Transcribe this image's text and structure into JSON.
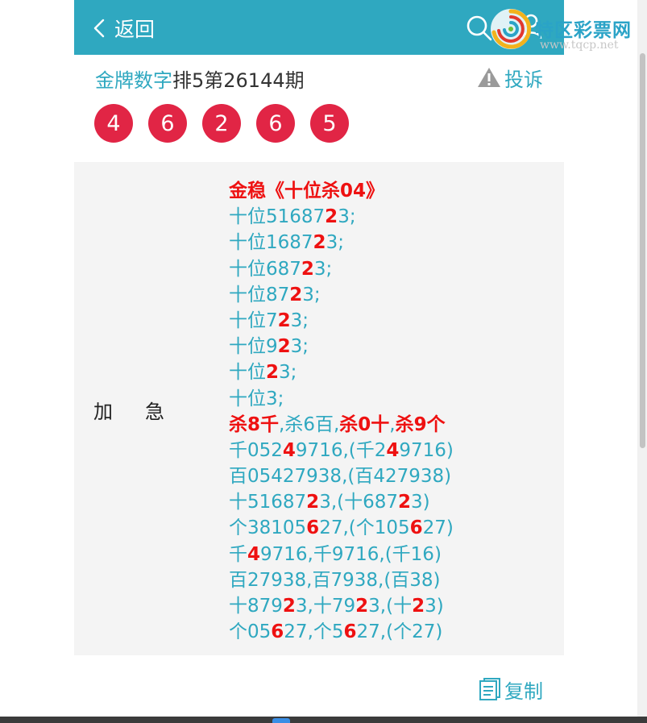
{
  "header": {
    "back_label": "返回",
    "search_icon": "search-icon",
    "user_icon": "user-icon",
    "background": "#2fa8c0"
  },
  "logo": {
    "name": "特区彩票网",
    "url": "www.tqcp.net"
  },
  "title": {
    "author": "金牌数字",
    "issue": "排5第26144期"
  },
  "complain": {
    "label": "投诉",
    "icon": "warning-icon"
  },
  "balls": [
    "4",
    "6",
    "2",
    "6",
    "5"
  ],
  "ball_color": "#e12545",
  "panel": {
    "label": "加急",
    "lines": [
      [
        {
          "t": "金稳《十位杀04》",
          "r": true
        }
      ],
      [
        {
          "t": "十位51687"
        },
        {
          "t": "2",
          "r": true
        },
        {
          "t": "3;"
        }
      ],
      [
        {
          "t": "十位1687"
        },
        {
          "t": "2",
          "r": true
        },
        {
          "t": "3;"
        }
      ],
      [
        {
          "t": "十位687"
        },
        {
          "t": "2",
          "r": true
        },
        {
          "t": "3;"
        }
      ],
      [
        {
          "t": "十位87"
        },
        {
          "t": "2",
          "r": true
        },
        {
          "t": "3;"
        }
      ],
      [
        {
          "t": "十位7"
        },
        {
          "t": "2",
          "r": true
        },
        {
          "t": "3;"
        }
      ],
      [
        {
          "t": "十位9"
        },
        {
          "t": "2",
          "r": true
        },
        {
          "t": "3;"
        }
      ],
      [
        {
          "t": "十位"
        },
        {
          "t": "2",
          "r": true
        },
        {
          "t": "3;"
        }
      ],
      [
        {
          "t": "十位3;"
        }
      ],
      [
        {
          "t": "杀8千",
          "r": true
        },
        {
          "t": ",杀6百,"
        },
        {
          "t": "杀0十",
          "r": true
        },
        {
          "t": ","
        },
        {
          "t": "杀9个",
          "r": true
        }
      ],
      [
        {
          "t": "千052"
        },
        {
          "t": "4",
          "r": true
        },
        {
          "t": "9716,(千2"
        },
        {
          "t": "4",
          "r": true
        },
        {
          "t": "9716)"
        }
      ],
      [
        {
          "t": "百05427938,(百427938)"
        }
      ],
      [
        {
          "t": "十51687"
        },
        {
          "t": "2",
          "r": true
        },
        {
          "t": "3,(十687"
        },
        {
          "t": "2",
          "r": true
        },
        {
          "t": "3)"
        }
      ],
      [
        {
          "t": "个38105"
        },
        {
          "t": "6",
          "r": true
        },
        {
          "t": "27,(个105"
        },
        {
          "t": "6",
          "r": true
        },
        {
          "t": "27)"
        }
      ],
      [
        {
          "t": "千"
        },
        {
          "t": "4",
          "r": true
        },
        {
          "t": "9716,千9716,(千16)"
        }
      ],
      [
        {
          "t": "百27938,百7938,(百38)"
        }
      ],
      [
        {
          "t": "十879"
        },
        {
          "t": "2",
          "r": true
        },
        {
          "t": "3,十79"
        },
        {
          "t": "2",
          "r": true
        },
        {
          "t": "3,(十"
        },
        {
          "t": "2",
          "r": true
        },
        {
          "t": "3)"
        }
      ],
      [
        {
          "t": "个05"
        },
        {
          "t": "6",
          "r": true
        },
        {
          "t": "27,个5"
        },
        {
          "t": "6",
          "r": true
        },
        {
          "t": "27,(个27)"
        }
      ]
    ]
  },
  "copy": {
    "label": "复制",
    "icon": "copy-icon"
  },
  "colors": {
    "accent": "#2fa8c0",
    "highlight": "#ee1111"
  }
}
